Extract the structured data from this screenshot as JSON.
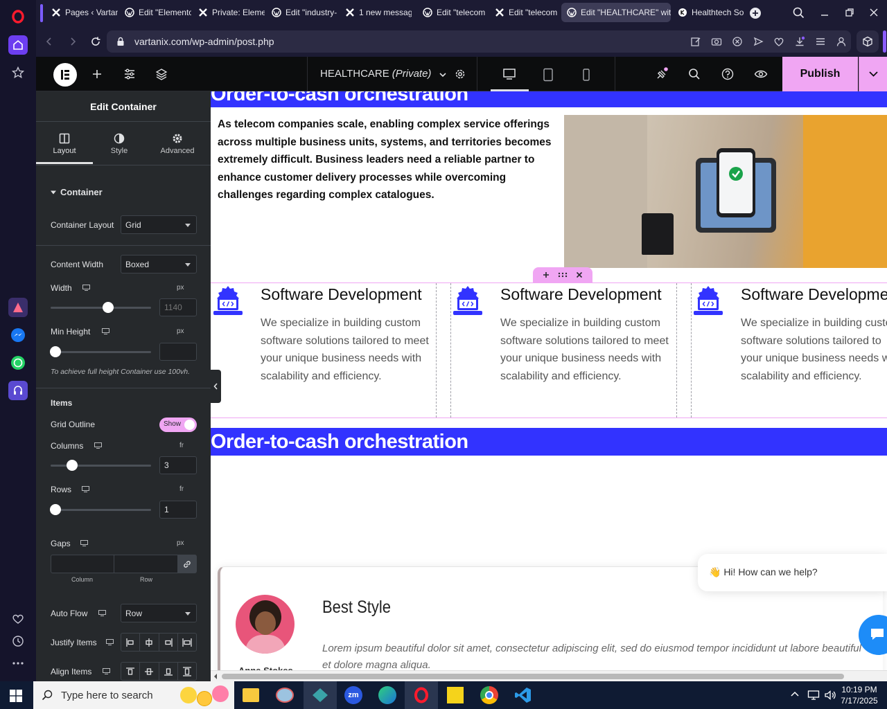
{
  "browser": {
    "tabs": [
      {
        "label": "Pages ‹ Vartan"
      },
      {
        "label": "Edit \"Elemento"
      },
      {
        "label": "Private: Eleme"
      },
      {
        "label": "Edit \"industry-"
      },
      {
        "label": "1 new messag"
      },
      {
        "label": "Edit \"telecom"
      },
      {
        "label": "Edit \"telecom"
      },
      {
        "label": "Edit \"HEALTHCARE\" with"
      },
      {
        "label": "Healthtech So"
      }
    ],
    "url": "vartanix.com/wp-admin/post.php"
  },
  "elementor": {
    "page_title": "HEALTHCARE",
    "page_status": "(Private)",
    "publish_label": "Publish"
  },
  "panel": {
    "header": "Edit Container",
    "tabs": [
      "Layout",
      "Style",
      "Advanced"
    ],
    "section_title": "Container",
    "container_layout_label": "Container Layout",
    "container_layout_value": "Grid",
    "content_width_label": "Content Width",
    "content_width_value": "Boxed",
    "width_label": "Width",
    "width_unit": "px",
    "width_placeholder": "1140",
    "width_slider": 0.58,
    "min_height_label": "Min Height",
    "min_height_unit": "px",
    "min_height_note": "To achieve full height Container use 100vh.",
    "items_title": "Items",
    "grid_outline_label": "Grid Outline",
    "grid_outline_toggle": "Show",
    "columns_label": "Columns",
    "columns_unit": "fr",
    "columns_value": "3",
    "columns_slider": 0.18,
    "rows_label": "Rows",
    "rows_unit": "fr",
    "rows_value": "1",
    "gaps_label": "Gaps",
    "gaps_unit": "px",
    "gap_column_label": "Column",
    "gap_row_label": "Row",
    "auto_flow_label": "Auto Flow",
    "auto_flow_value": "Row",
    "justify_items_label": "Justify Items",
    "align_items_label": "Align Items"
  },
  "canvas": {
    "top_heading": "Order-to-cash orchestration",
    "intro_text": "As telecom companies scale, enabling complex service offerings across multiple business units, systems, and territories becomes extremely difficult. Business leaders need a reliable partner to enhance customer delivery processes while overcoming challenges regarding complex catalogues.",
    "cards": [
      {
        "title": "Software Development",
        "text": "We specialize in building custom software solutions tailored to meet your unique business needs with scalability and efficiency."
      },
      {
        "title": "Software Development",
        "text": "We specialize in building custom software solutions tailored to meet your unique business needs with scalability and efficiency."
      },
      {
        "title": "Software Developme",
        "text": "We specialize in building custo software solutions tailored to your unique business needs w scalability and efficiency."
      }
    ],
    "second_heading": "Order-to-cash orchestration",
    "testimonial": {
      "title": "Best Style",
      "text": "Lorem ipsum beautiful dolor sit amet, consectetur adipiscing elit, sed do eiusmod tempor incididunt ut labore beautiful et dolore magna aliqua.",
      "author": "Anna Stokes"
    },
    "chat_bubble": "👋 Hi! How can we help?"
  },
  "taskbar": {
    "search_placeholder": "Type here to search",
    "time": "10:19 PM",
    "date": "7/17/2025"
  },
  "colors": {
    "accent_blue": "#3233ff",
    "publish_pink": "#f0a6f3"
  }
}
